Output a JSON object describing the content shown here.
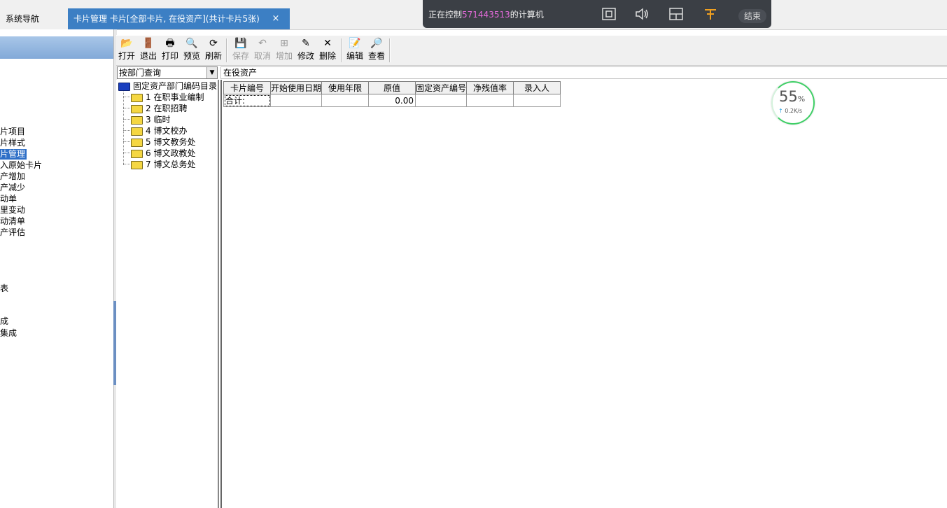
{
  "tabs": {
    "nav_label": "系统导航",
    "active_label": "卡片管理 卡片[全部卡片, 在役资产](共计卡片5张)",
    "close_glyph": "×"
  },
  "remote": {
    "prefix": "正在控制",
    "machine_id": "571443513",
    "suffix": "的计算机",
    "end_label": "结束"
  },
  "leftnav": {
    "items": [
      {
        "label": "片项目"
      },
      {
        "label": "片样式"
      },
      {
        "label": "片管理",
        "selected": true
      },
      {
        "label": "入原始卡片"
      },
      {
        "label": "产增加"
      },
      {
        "label": "产减少"
      },
      {
        "label": "动单"
      },
      {
        "label": "里变动"
      },
      {
        "label": "动清单"
      },
      {
        "label": "产评估"
      },
      {
        "label": "表"
      },
      {
        "label": "成"
      },
      {
        "label": "集成"
      }
    ]
  },
  "toolbar": {
    "open": "打开",
    "exit": "退出",
    "print": "打印",
    "preview": "预览",
    "refresh": "刷新",
    "save": "保存",
    "cancel": "取消",
    "add": "增加",
    "modify": "修改",
    "delete": "删除",
    "edit": "编辑",
    "view": "查看"
  },
  "filter": {
    "dept_query": "按部门查询",
    "status": "在役资产"
  },
  "tree": {
    "root": "固定资产部门编码目录",
    "children": [
      {
        "code": "1",
        "name": "在职事业编制"
      },
      {
        "code": "2",
        "name": "在职招聘"
      },
      {
        "code": "3",
        "name": "临时"
      },
      {
        "code": "4",
        "name": "博文校办"
      },
      {
        "code": "5",
        "name": "博文教务处"
      },
      {
        "code": "6",
        "name": "博文政教处"
      },
      {
        "code": "7",
        "name": "博文总务处"
      }
    ]
  },
  "grid": {
    "columns": [
      "卡片编号",
      "开始使用日期",
      "使用年限",
      "原值",
      "固定资产编号",
      "净残值率",
      "录入人"
    ],
    "total_label": "合计:",
    "total_value": "0.00"
  },
  "speed": {
    "percent": "55",
    "percent_unit": "%",
    "rate": "0.2K/s",
    "arrow": "↑"
  }
}
